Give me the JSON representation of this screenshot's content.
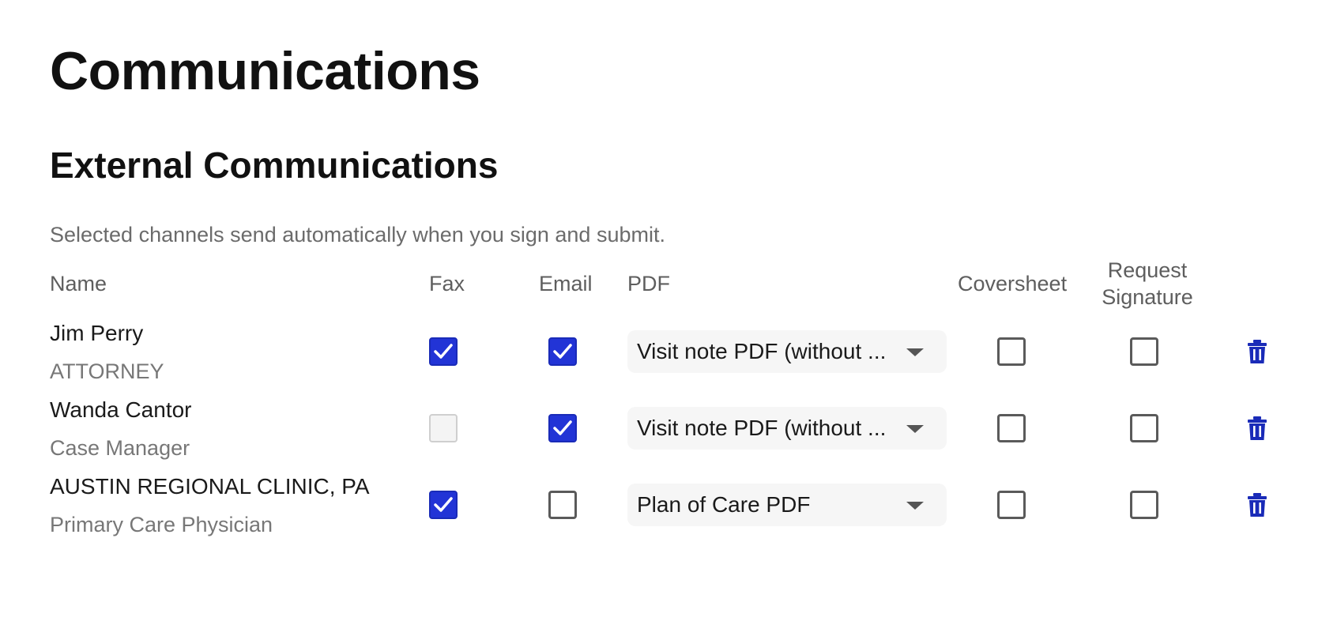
{
  "page": {
    "title": "Communications"
  },
  "section": {
    "title": "External Communications",
    "description": "Selected channels send automatically when you sign and submit."
  },
  "columns": {
    "name": "Name",
    "fax": "Fax",
    "email": "Email",
    "pdf": "PDF",
    "coversheet": "Coversheet",
    "request_signature_line1": "Request",
    "request_signature_line2": "Signature"
  },
  "colors": {
    "accent": "#2234d6",
    "trash_icon": "#1a2bb8"
  },
  "recipients": [
    {
      "name": "Jim Perry",
      "role": "ATTORNEY",
      "fax": "checked",
      "email": "checked",
      "pdf": "Visit note PDF (without ...",
      "coversheet": "unchecked",
      "request_signature": "unchecked",
      "delete_icon": "trash-icon"
    },
    {
      "name": "Wanda Cantor",
      "role": "Case Manager",
      "fax": "disabled",
      "email": "checked",
      "pdf": "Visit note PDF (without ...",
      "coversheet": "unchecked",
      "request_signature": "unchecked",
      "delete_icon": "trash-icon"
    },
    {
      "name": "AUSTIN REGIONAL CLINIC, PA",
      "role": "Primary Care Physician",
      "fax": "checked",
      "email": "unchecked",
      "pdf": "Plan of Care PDF",
      "coversheet": "unchecked",
      "request_signature": "unchecked",
      "delete_icon": "trash-icon"
    }
  ]
}
